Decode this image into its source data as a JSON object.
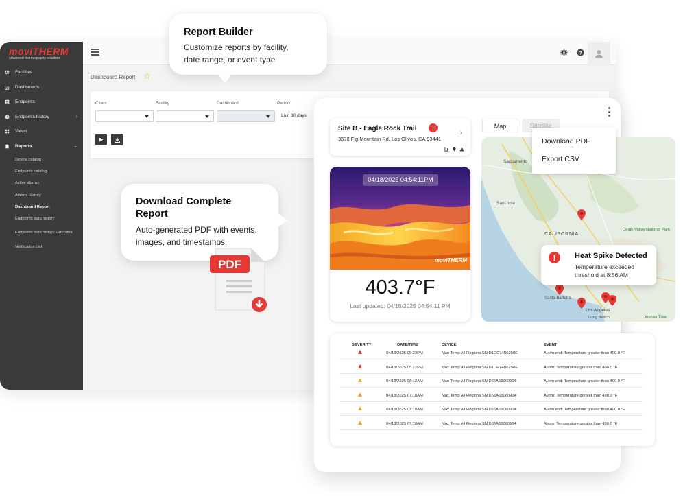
{
  "brand": {
    "logo_text": "moviTHERM",
    "tagline": "advanced thermography solutions"
  },
  "sidebar": {
    "items": [
      {
        "label": "Facilities",
        "icon": "globe-icon"
      },
      {
        "label": "Dashboards",
        "icon": "chart-icon"
      },
      {
        "label": "Endpoints",
        "icon": "list-icon"
      },
      {
        "label": "Endpoints history",
        "icon": "clock-icon"
      },
      {
        "label": "Views",
        "icon": "grid-icon"
      },
      {
        "label": "Reports",
        "icon": "document-icon"
      }
    ],
    "sub_items": [
      "Device catalog",
      "Endpoints catalog",
      "Active alarms",
      "Alarms History",
      "Dashboard Report",
      "Endpoints data history",
      "Endpoints data history Extended",
      "Notification List"
    ]
  },
  "page": {
    "title": "Dashboard Report",
    "filters": {
      "client_label": "Client",
      "facility_label": "Facility",
      "dashboard_label": "Dashboard",
      "period_label": "Period",
      "period_value": "Last 30 days"
    }
  },
  "callouts": {
    "report_builder": {
      "title": "Report Builder",
      "text": "Customize reports by facility, date range, or event type"
    },
    "download": {
      "title": "Download Complete Report",
      "text": "Auto-generated PDF with events, images, and timestamps.",
      "pdf_label": "PDF"
    }
  },
  "site": {
    "name": "Site B - Eagle Rock Trail",
    "address": "3678 Fig Mountain Rd, Los Olivos, CA 93441",
    "alert": "!"
  },
  "thermal": {
    "timestamp": "04/18/2025 04:54:11PM",
    "watermark": "moviTHERM",
    "temperature": "403.7°F",
    "updated": "Last updated: 04/18/2025 04:54:11 PM"
  },
  "map": {
    "tabs": [
      "Map",
      "Satellite"
    ],
    "menu": [
      "Download PDF",
      "Export CSV"
    ],
    "labels": [
      "Sacramento",
      "San Jose",
      "CALIFORNIA",
      "Death Valley National Park",
      "Santa Barbara",
      "Los Angeles",
      "Long Beach",
      "Joshua Tree"
    ],
    "alert": {
      "title": "Heat Spike Detected",
      "text": "Temperature exceeded threshold at 8:56 AM"
    }
  },
  "events": {
    "headers": [
      "SEVERITY",
      "DATE/TIME",
      "DEVICE",
      "EVENT"
    ],
    "rows": [
      {
        "severity": "critical",
        "datetime": "04/18/2025 05:23PM",
        "device": "Max Temp All Regions SN D1DE74B6250E",
        "event": "Alarm end: Temperature greater than 400.0 °F"
      },
      {
        "severity": "critical",
        "datetime": "04/18/2025 05:22PM",
        "device": "Max Temp All Regions SN D1DE74B6250E",
        "event": "Alarm: Temperature greater than 400.0 °F"
      },
      {
        "severity": "warning",
        "datetime": "04/18/2025 08:12AM",
        "device": "Max Temp All Regions SN D66A63060914",
        "event": "Alarm end: Temperature greater than 400.0 °F"
      },
      {
        "severity": "warning",
        "datetime": "04/18/2025 07:18AM",
        "device": "Max Temp All Regions SN D66A63060914",
        "event": "Alarm: Temperature greater than 400.0 °F"
      },
      {
        "severity": "warning",
        "datetime": "04/18/2025 07:18AM",
        "device": "Max Temp All Regions SN D66A63060914",
        "event": "Alarm end: Temperature greater than 400.0 °F"
      },
      {
        "severity": "warning",
        "datetime": "04/18/2025 07:18AM",
        "device": "Max Temp All Regions SN D66A63060914",
        "event": "Alarm: Temperature greater than 400.0 °F"
      }
    ]
  },
  "colors": {
    "brand_red": "#e53935",
    "sidebar_bg": "#3b3b3b",
    "warning": "#f2a42b"
  }
}
